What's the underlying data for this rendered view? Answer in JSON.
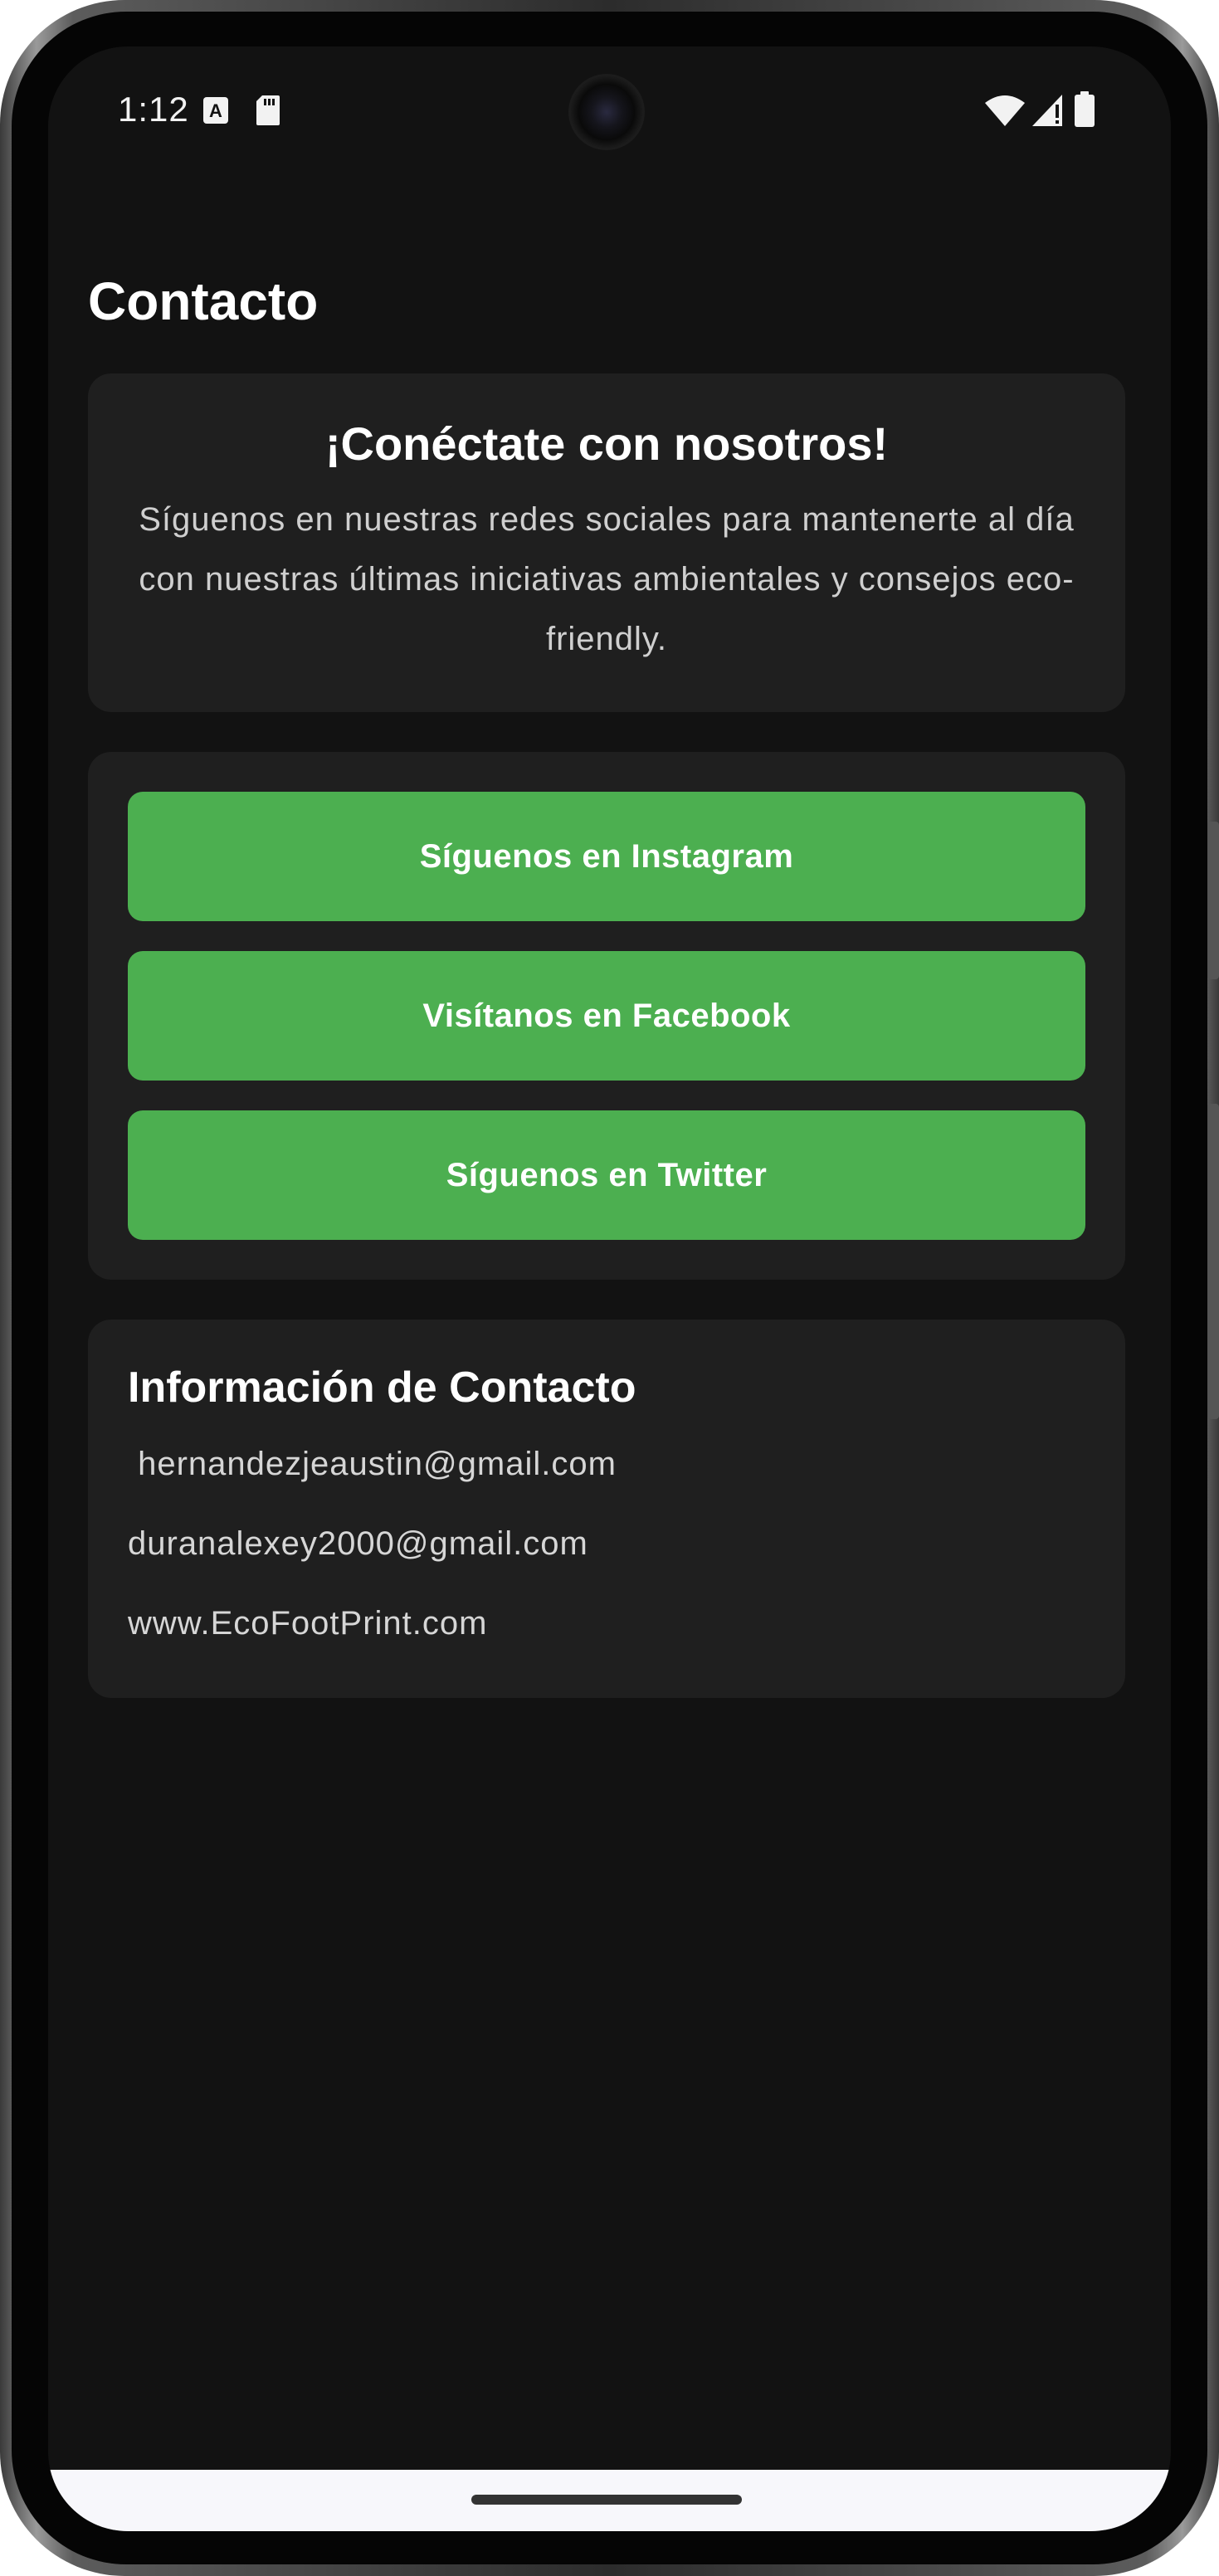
{
  "status_bar": {
    "time": "1:12",
    "left_icons": [
      "accessibility-a-icon",
      "sd-card-icon"
    ],
    "right_icons": [
      "wifi-icon",
      "cell-signal-icon",
      "battery-icon"
    ]
  },
  "header": {
    "title": "Contacto"
  },
  "intro": {
    "title": "¡Conéctate con nosotros!",
    "text": "Síguenos en nuestras redes sociales para mantenerte al día con nuestras últimas iniciativas ambientales y consejos eco-friendly."
  },
  "social": {
    "instagram_label": "Síguenos en Instagram",
    "facebook_label": "Visítanos en Facebook",
    "twitter_label": "Síguenos en Twitter"
  },
  "contact_info": {
    "title": "Información de Contacto",
    "email_1": " hernandezjeaustin@gmail.com",
    "email_2": "duranalexey2000@gmail.com",
    "website": "www.EcoFootPrint.com"
  },
  "colors": {
    "background": "#121212",
    "card": "#1f1f1f",
    "accent_green": "#4caf50"
  }
}
